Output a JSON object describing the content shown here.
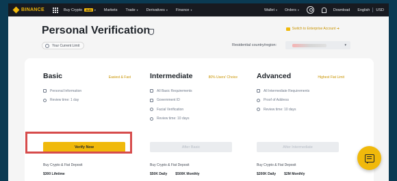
{
  "nav": {
    "logo_text": "BINANCE",
    "items": [
      {
        "label": "Buy Crypto",
        "badge": "AUD",
        "caret": "▾"
      },
      {
        "label": "Markets"
      },
      {
        "label": "Trade",
        "caret": "▾"
      },
      {
        "label": "Derivatives",
        "caret": "▾"
      },
      {
        "label": "Finance",
        "caret": "▾"
      }
    ],
    "wallet": "Wallet",
    "orders": "Orders",
    "download": "Download",
    "language": "English",
    "currency": "USD",
    "caret": "▾"
  },
  "header": {
    "title": "Personal Verification",
    "enterprise_link": "Switch to Enterprise Account ➔",
    "current_limit": "Your Current Limit",
    "country_label": "Residential country/region:",
    "country_caret": "▾"
  },
  "tiers": [
    {
      "title": "Basic",
      "tag": "Easiest & Fast",
      "requirements": [
        "Personal Information",
        "Review time: 1 day"
      ],
      "button": "Verify Now",
      "deposit_label": "Buy Crypto & Fiat Deposit",
      "deposit_values": [
        "$300 Lifetime"
      ]
    },
    {
      "title": "Intermediate",
      "tag": "80% Users' Choice",
      "requirements": [
        "All Basic Requirements",
        "Government ID",
        "Facial Verification",
        "Review time: 10 days"
      ],
      "button": "After Basic",
      "deposit_label": "Buy Crypto & Fiat Deposit",
      "deposit_values": [
        "$50K Daily",
        "$500K Monthly"
      ]
    },
    {
      "title": "Advanced",
      "tag": "Highest Fiat Limit",
      "requirements": [
        "All Intermediate Requirements",
        "Proof of Address",
        "Review time: 10 days"
      ],
      "button": "After Intermediate",
      "deposit_label": "Buy Crypto & Fiat Deposit",
      "deposit_values": [
        "$200K Daily",
        "$2M Monthly"
      ]
    }
  ],
  "colors": {
    "brand": "#f0b90b",
    "nav_bg": "#181a20",
    "highlight": "#d64b4b"
  }
}
